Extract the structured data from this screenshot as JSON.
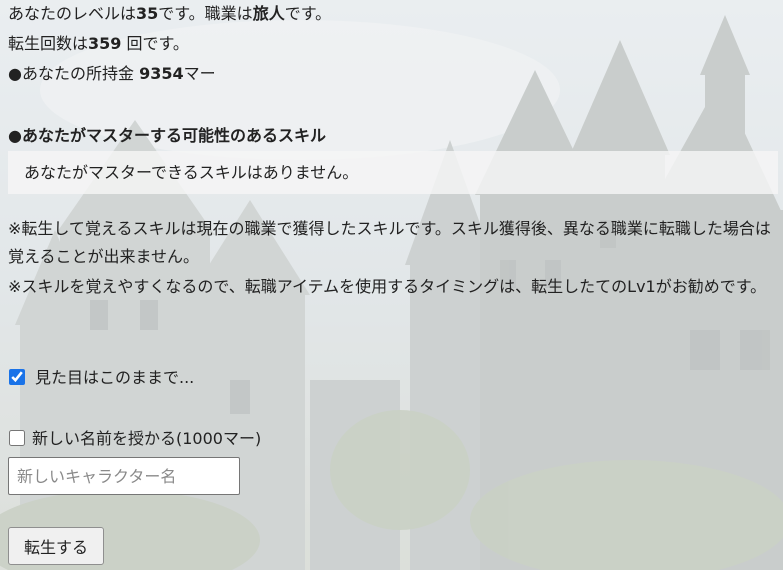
{
  "status": {
    "level_pre": "あなたのレベルは",
    "level_value": "35",
    "level_mid": "です。職業は",
    "job": "旅人",
    "level_post": "です。",
    "rebirth_pre": "転生回数は",
    "rebirth_value": "359",
    "rebirth_post": " 回です。",
    "money_pre": "●あなたの所持金 ",
    "money_value": "9354",
    "money_post": "マー"
  },
  "skills": {
    "heading": "●あなたがマスターする可能性のあるスキル",
    "empty_message": "あなたがマスターできるスキルはありません。"
  },
  "notes": {
    "note1": "※転生して覚えるスキルは現在の職業で獲得したスキルです。スキル獲得後、異なる職業に転職した場合は覚えることが出来ません。",
    "note2": "※スキルを覚えやすくなるので、転職アイテムを使用するタイミングは、転生したてのLv1がお勧めです。"
  },
  "form": {
    "keep_appearance_label": "見た目はこのままで...",
    "keep_appearance_checked": true,
    "new_name_label": " 新しい名前を授かる(1000マー)",
    "new_name_checked": false,
    "new_name_placeholder": "新しいキャラクター名",
    "submit_label": "転生する"
  }
}
